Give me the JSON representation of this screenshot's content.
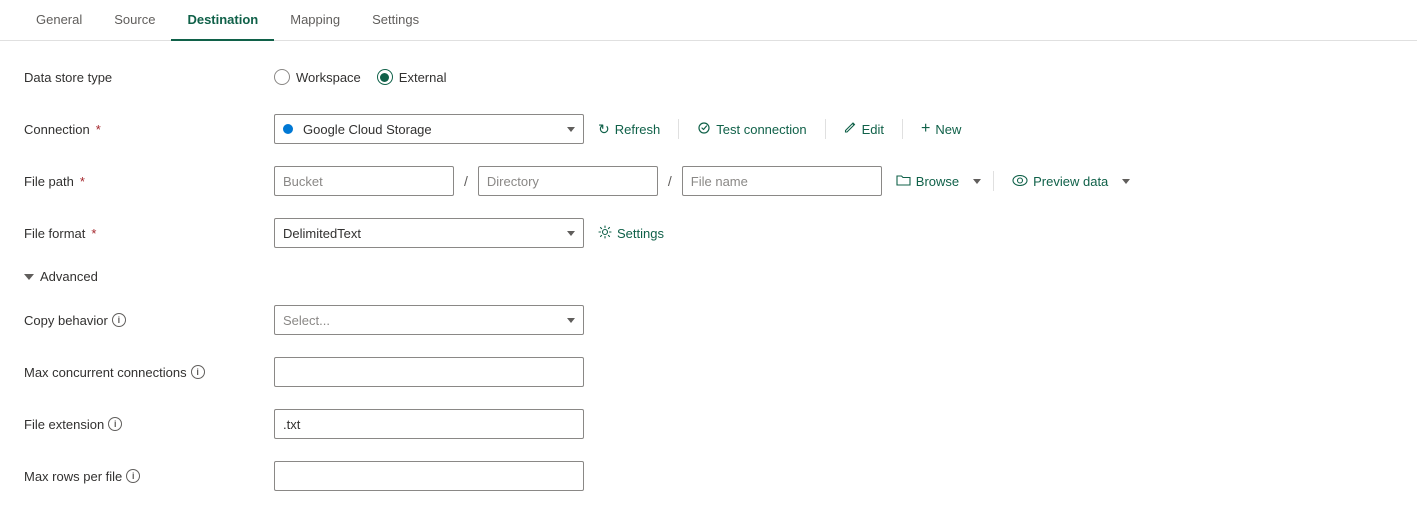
{
  "tabs": [
    {
      "id": "general",
      "label": "General",
      "active": false
    },
    {
      "id": "source",
      "label": "Source",
      "active": false
    },
    {
      "id": "destination",
      "label": "Destination",
      "active": true
    },
    {
      "id": "mapping",
      "label": "Mapping",
      "active": false
    },
    {
      "id": "settings",
      "label": "Settings",
      "active": false
    }
  ],
  "form": {
    "data_store_type_label": "Data store type",
    "workspace_label": "Workspace",
    "external_label": "External",
    "connection_label": "Connection",
    "connection_value": "Google Cloud Storage",
    "refresh_label": "Refresh",
    "test_connection_label": "Test connection",
    "edit_label": "Edit",
    "new_label": "New",
    "file_path_label": "File path",
    "bucket_placeholder": "Bucket",
    "directory_placeholder": "Directory",
    "file_name_placeholder": "File name",
    "browse_label": "Browse",
    "preview_data_label": "Preview data",
    "file_format_label": "File format",
    "file_format_value": "DelimitedText",
    "settings_label": "Settings",
    "advanced_label": "Advanced",
    "copy_behavior_label": "Copy behavior",
    "copy_behavior_placeholder": "Select...",
    "max_concurrent_label": "Max concurrent connections",
    "file_extension_label": "File extension",
    "file_extension_value": ".txt",
    "max_rows_label": "Max rows per file"
  }
}
